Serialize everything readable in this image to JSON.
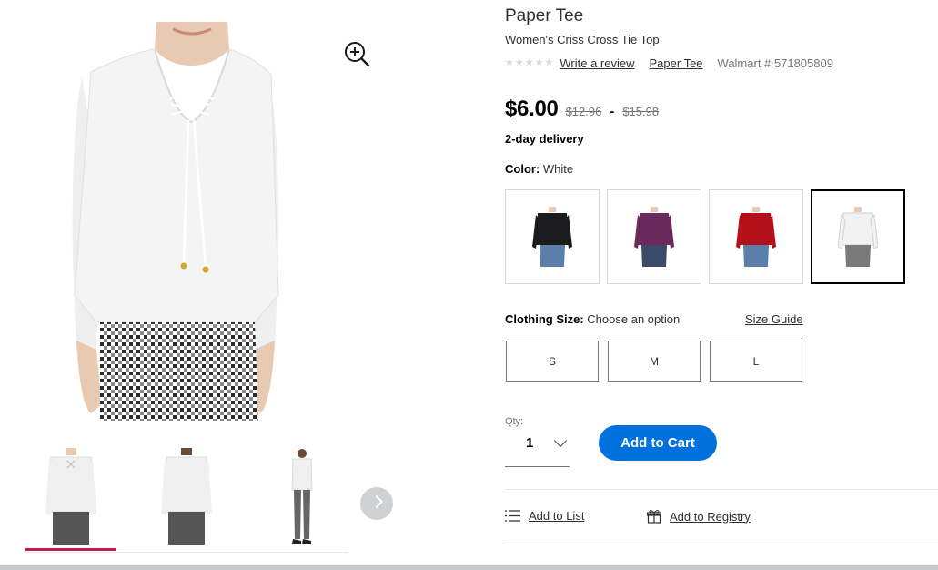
{
  "product": {
    "title": "Paper Tee",
    "subtitle": "Women's Criss Cross Tie Top",
    "review_link": "Write a review",
    "brand_link": "Paper Tee",
    "walmart_number": "Walmart # 571805809",
    "star_icons": [
      "★",
      "★",
      "★",
      "★",
      "★"
    ]
  },
  "pricing": {
    "price": "$6.00",
    "was_low": "$12.96",
    "dash": "-",
    "was_high": "$15.98"
  },
  "delivery": "2-day delivery",
  "color": {
    "label": "Color:",
    "value": "White",
    "swatches": [
      {
        "name": "Black",
        "hex": "#1b1b1d"
      },
      {
        "name": "Purple",
        "hex": "#6b2a5e"
      },
      {
        "name": "Red",
        "hex": "#b3101c"
      },
      {
        "name": "White",
        "hex": "#f2f2f2"
      }
    ]
  },
  "size": {
    "label": "Clothing Size:",
    "value": "Choose an option",
    "guide": "Size Guide",
    "options": [
      "S",
      "M",
      "L"
    ]
  },
  "quantity": {
    "label": "Qty:",
    "value": "1"
  },
  "add_to_cart": "Add to Cart",
  "actions": {
    "add_to_list": "Add to List",
    "add_to_registry": "Add to Registry"
  },
  "colors": {
    "accent_blue": "#0071dc",
    "active_thumb": "#c2185b"
  }
}
